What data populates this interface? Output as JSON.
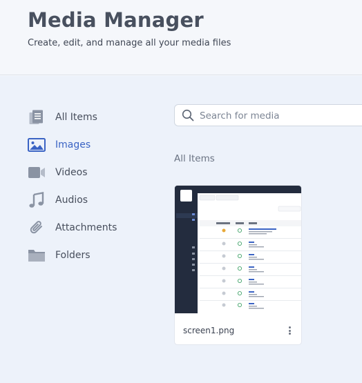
{
  "header": {
    "title": "Media Manager",
    "subtitle": "Create, edit, and manage all your media files"
  },
  "sidebar": {
    "items": [
      {
        "label": "All Items",
        "icon": "document-icon",
        "active": false
      },
      {
        "label": "Images",
        "icon": "image-icon",
        "active": true
      },
      {
        "label": "Videos",
        "icon": "video-icon",
        "active": false
      },
      {
        "label": "Audios",
        "icon": "music-note-icon",
        "active": false
      },
      {
        "label": "Attachments",
        "icon": "paperclip-icon",
        "active": false
      },
      {
        "label": "Folders",
        "icon": "folder-icon",
        "active": false
      }
    ]
  },
  "search": {
    "placeholder": "Search for media",
    "value": ""
  },
  "section": {
    "title": "All Items"
  },
  "media_items": [
    {
      "name": "screen1.png"
    }
  ],
  "colors": {
    "accent": "#3a63c4",
    "icon_gray": "#8a93a3",
    "page_bg": "#edf2fa"
  }
}
